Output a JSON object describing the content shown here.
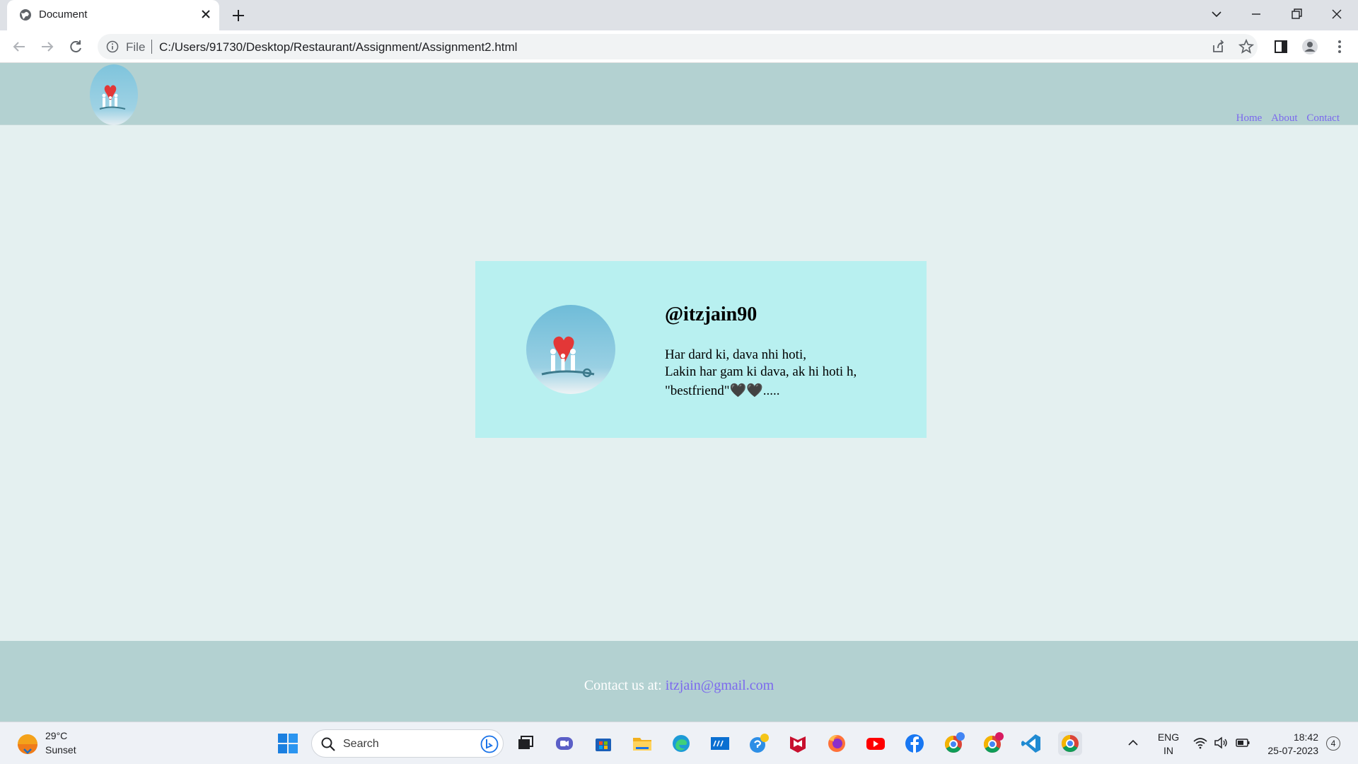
{
  "browser": {
    "tab_title": "Document",
    "url_scheme": "File",
    "url": "C:/Users/91730/Desktop/Restaurant/Assignment/Assignment2.html"
  },
  "page": {
    "nav": [
      "Home",
      "About",
      "Contact"
    ],
    "profile": {
      "handle": "@itzjain90",
      "bio_line1": "Har dard ki, dava nhi hoti,",
      "bio_line2": "Lakin har gam ki dava, ak hi hoti h,",
      "bio_line3": "\"bestfriend\"🖤🖤....."
    },
    "footer": {
      "label": "Contact us at: ",
      "email": "itzjain@gmail.com"
    }
  },
  "taskbar": {
    "weather_temp": "29°C",
    "weather_desc": "Sunset",
    "search_placeholder": "Search",
    "lang_1": "ENG",
    "lang_2": "IN",
    "time": "18:42",
    "date": "25-07-2023",
    "notification_count": "4"
  },
  "colors": {
    "header_bg": "#b3d1d1",
    "page_bg": "#e4f0f0",
    "card_bg": "#b8f0f0",
    "link": "#7b68ee"
  }
}
